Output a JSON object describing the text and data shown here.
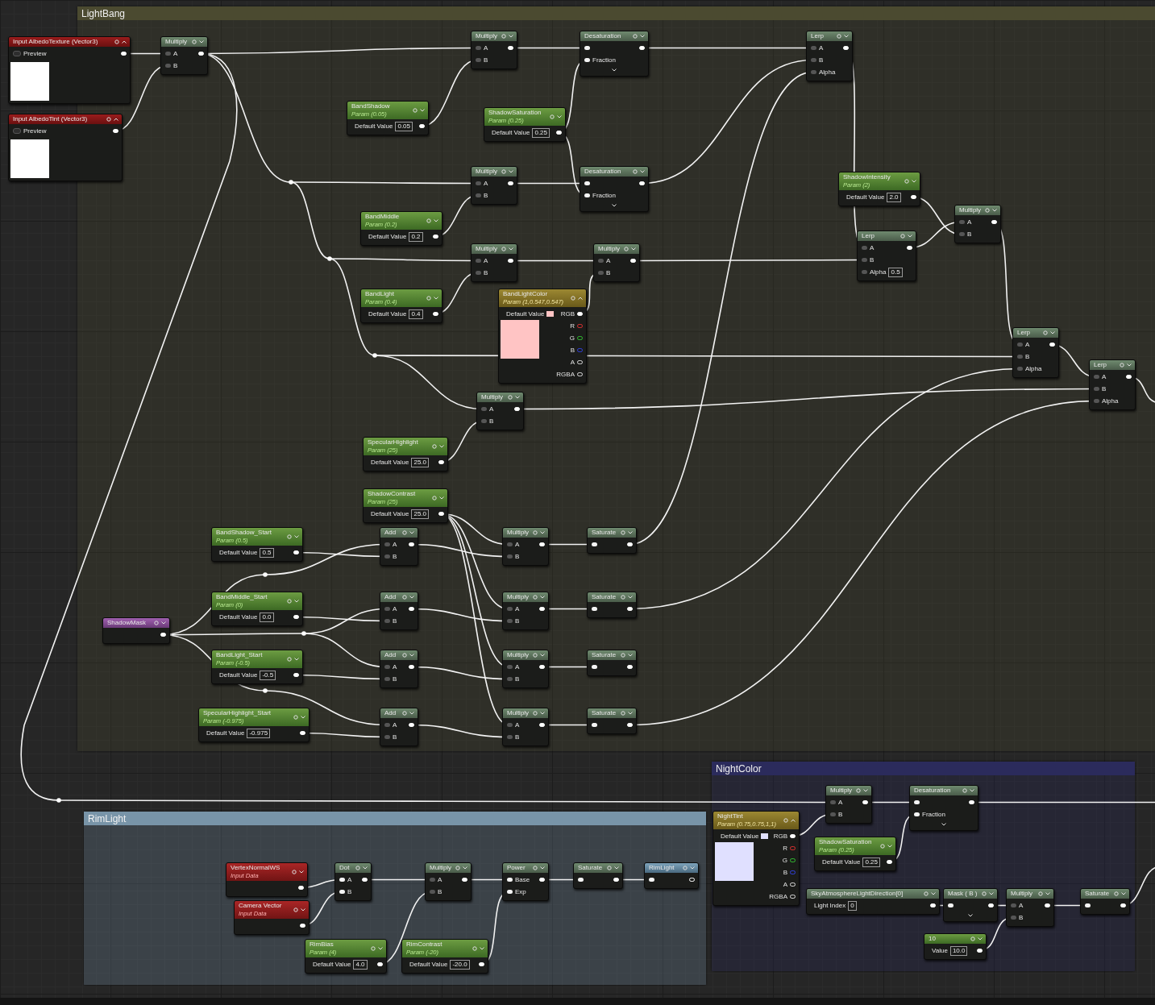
{
  "comments": [
    {
      "title": "LightBang",
      "color": "#4b4a30"
    },
    {
      "title": "RimLight",
      "color": "#7894a8"
    },
    {
      "title": "NightColor",
      "color": "#2b2b5c"
    }
  ],
  "nodes": [
    {
      "kind": "texture",
      "title": "Input AlbedoTexture (Vector3)",
      "expanded": true,
      "field": {
        "label": "Preview"
      }
    },
    {
      "kind": "texture",
      "title": "Input AlbedoTint (Vector3)",
      "expanded": true,
      "field": {
        "label": "Preview"
      }
    },
    {
      "kind": "function",
      "title": "Multiply",
      "expanded": false,
      "inputs": [
        {
          "label": "A",
          "filled": false
        },
        {
          "label": "B",
          "filled": false
        }
      ]
    },
    {
      "kind": "function",
      "title": "Multiply",
      "expanded": false,
      "inputs": [
        {
          "label": "A",
          "filled": false
        },
        {
          "label": "B",
          "filled": false
        }
      ]
    },
    {
      "kind": "param",
      "title": "BandShadow",
      "subtitle": "Param (0.05)",
      "expanded": false,
      "field": {
        "label": "Default Value",
        "value": "0.05"
      }
    },
    {
      "kind": "param",
      "title": "ShadowSaturation",
      "subtitle": "Param (0.25)",
      "expanded": false,
      "field": {
        "label": "Default Value",
        "value": "0.25"
      }
    },
    {
      "kind": "collapsible",
      "title": "Desaturation",
      "expanded": false,
      "inputs": [
        {
          "filled": true
        },
        {
          "label": "Fraction",
          "filled": true
        }
      ]
    },
    {
      "kind": "function",
      "title": "Lerp",
      "expanded": false,
      "inputs": [
        {
          "label": "A",
          "filled": false
        },
        {
          "label": "B",
          "filled": false
        },
        {
          "label": "Alpha",
          "filled": false
        }
      ]
    },
    {
      "kind": "function",
      "title": "Multiply",
      "expanded": false,
      "inputs": [
        {
          "label": "A",
          "filled": false
        },
        {
          "label": "B",
          "filled": false
        }
      ]
    },
    {
      "kind": "collapsible",
      "title": "Desaturation",
      "expanded": false,
      "inputs": [
        {
          "filled": true
        },
        {
          "label": "Fraction",
          "filled": true
        }
      ]
    },
    {
      "kind": "param",
      "title": "BandMiddle",
      "subtitle": "Param (0.2)",
      "expanded": false,
      "field": {
        "label": "Default Value",
        "value": "0.2"
      }
    },
    {
      "kind": "param",
      "title": "ShadowIntensity",
      "subtitle": "Param (2)",
      "expanded": false,
      "field": {
        "label": "Default Value",
        "value": "2.0"
      }
    },
    {
      "kind": "function",
      "title": "Multiply",
      "expanded": false,
      "inputs": [
        {
          "label": "A",
          "filled": false
        },
        {
          "label": "B",
          "filled": false
        }
      ]
    },
    {
      "kind": "function",
      "title": "Multiply",
      "expanded": false,
      "inputs": [
        {
          "label": "A",
          "filled": false
        },
        {
          "label": "B",
          "filled": false
        }
      ]
    },
    {
      "kind": "function",
      "title": "Multiply",
      "expanded": false,
      "inputs": [
        {
          "label": "A",
          "filled": false
        },
        {
          "label": "B",
          "filled": false
        }
      ]
    },
    {
      "kind": "function",
      "title": "Lerp",
      "expanded": false,
      "inputs": [
        {
          "label": "A",
          "filled": false
        },
        {
          "label": "B",
          "filled": false
        },
        {
          "label": "Alpha",
          "value": "0.5",
          "filled": false
        }
      ]
    },
    {
      "kind": "param",
      "title": "BandLight",
      "subtitle": "Param (0.4)",
      "expanded": false,
      "field": {
        "label": "Default Value",
        "value": "0.4"
      }
    },
    {
      "kind": "vector",
      "title": "BandLightColor",
      "subtitle": "Param (1,0.547,0.547)",
      "expanded": true,
      "field": {
        "label": "Default Value"
      },
      "outputs": [
        "RGB",
        "R",
        "G",
        "B",
        "A",
        "RGBA"
      ],
      "color": "#ffc4c4"
    },
    {
      "kind": "function",
      "title": "Lerp",
      "expanded": false,
      "inputs": [
        {
          "label": "A",
          "filled": false
        },
        {
          "label": "B",
          "filled": false
        },
        {
          "label": "Alpha",
          "filled": false
        }
      ]
    },
    {
      "kind": "function",
      "title": "Lerp",
      "expanded": false,
      "inputs": [
        {
          "label": "A",
          "filled": false
        },
        {
          "label": "B",
          "filled": false
        },
        {
          "label": "Alpha",
          "filled": false
        }
      ]
    },
    {
      "kind": "function",
      "title": "Multiply",
      "expanded": false,
      "inputs": [
        {
          "label": "A",
          "filled": false
        },
        {
          "label": "B",
          "filled": false
        }
      ]
    },
    {
      "kind": "param",
      "title": "SpecularHighlight",
      "subtitle": "Param (25)",
      "expanded": false,
      "field": {
        "label": "Default Value",
        "value": "25.0"
      }
    },
    {
      "kind": "param",
      "title": "ShadowContrast",
      "subtitle": "Param (25)",
      "expanded": false,
      "field": {
        "label": "Default Value",
        "value": "25.0"
      }
    },
    {
      "kind": "param",
      "title": "BandShadow_Start",
      "subtitle": "Param (0.5)",
      "expanded": false,
      "field": {
        "label": "Default Value",
        "value": "0.5"
      }
    },
    {
      "kind": "function",
      "title": "Add",
      "expanded": false,
      "inputs": [
        {
          "label": "A",
          "filled": false
        },
        {
          "label": "B",
          "filled": false
        }
      ]
    },
    {
      "kind": "function",
      "title": "Multiply",
      "expanded": false,
      "inputs": [
        {
          "label": "A",
          "filled": false
        },
        {
          "label": "B",
          "filled": false
        }
      ]
    },
    {
      "kind": "function",
      "title": "Saturate",
      "expanded": false,
      "inputs": [
        {
          "filled": true
        }
      ]
    },
    {
      "kind": "mask",
      "title": "ShadowMask",
      "expanded": false
    },
    {
      "kind": "param",
      "title": "BandMiddle_Start",
      "subtitle": "Param (0)",
      "expanded": false,
      "field": {
        "label": "Default Value",
        "value": "0.0"
      }
    },
    {
      "kind": "function",
      "title": "Add",
      "expanded": false,
      "inputs": [
        {
          "label": "A",
          "filled": false
        },
        {
          "label": "B",
          "filled": false
        }
      ]
    },
    {
      "kind": "function",
      "title": "Multiply",
      "expanded": false,
      "inputs": [
        {
          "label": "A",
          "filled": false
        },
        {
          "label": "B",
          "filled": false
        }
      ]
    },
    {
      "kind": "function",
      "title": "Saturate",
      "expanded": false,
      "inputs": [
        {
          "filled": true
        }
      ]
    },
    {
      "kind": "param",
      "title": "BandLight_Start",
      "subtitle": "Param (-0.5)",
      "expanded": false,
      "field": {
        "label": "Default Value",
        "value": "-0.5"
      }
    },
    {
      "kind": "function",
      "title": "Add",
      "expanded": false,
      "inputs": [
        {
          "label": "A",
          "filled": false
        },
        {
          "label": "B",
          "filled": false
        }
      ]
    },
    {
      "kind": "function",
      "title": "Multiply",
      "expanded": false,
      "inputs": [
        {
          "label": "A",
          "filled": false
        },
        {
          "label": "B",
          "filled": false
        }
      ]
    },
    {
      "kind": "function",
      "title": "Saturate",
      "expanded": false,
      "inputs": [
        {
          "filled": true
        }
      ]
    },
    {
      "kind": "param",
      "title": "SpecularHighlight_Start",
      "subtitle": "Param (-0.975)",
      "expanded": false,
      "field": {
        "label": "Default Value",
        "value": "-0.975"
      }
    },
    {
      "kind": "function",
      "title": "Add",
      "expanded": false,
      "inputs": [
        {
          "label": "A",
          "filled": false
        },
        {
          "label": "B",
          "filled": false
        }
      ]
    },
    {
      "kind": "function",
      "title": "Multiply",
      "expanded": false,
      "inputs": [
        {
          "label": "A",
          "filled": false
        },
        {
          "label": "B",
          "filled": false
        }
      ]
    },
    {
      "kind": "function",
      "title": "Saturate",
      "expanded": false,
      "inputs": [
        {
          "filled": true
        }
      ]
    },
    {
      "kind": "input",
      "title": "VertexNormalWS",
      "subtitle": "Input Data",
      "expanded": false
    },
    {
      "kind": "input",
      "title": "Camera Vector",
      "subtitle": "Input Data",
      "expanded": false
    },
    {
      "kind": "function",
      "title": "Dot",
      "expanded": false,
      "inputs": [
        {
          "label": "A",
          "filled": true
        },
        {
          "label": "B",
          "filled": true
        }
      ]
    },
    {
      "kind": "function",
      "title": "Multiply",
      "expanded": false,
      "inputs": [
        {
          "label": "A",
          "filled": false
        },
        {
          "label": "B",
          "filled": false
        }
      ]
    },
    {
      "kind": "function",
      "title": "Power",
      "expanded": false,
      "inputs": [
        {
          "label": "Base",
          "filled": true
        },
        {
          "label": "Exp",
          "filled": true
        }
      ]
    },
    {
      "kind": "function",
      "title": "Saturate",
      "expanded": false,
      "inputs": [
        {
          "filled": true
        }
      ]
    },
    {
      "kind": "output",
      "title": "RimLight",
      "expanded": false
    },
    {
      "kind": "param",
      "title": "RimBias",
      "subtitle": "Param (4)",
      "expanded": false,
      "field": {
        "label": "Default Value",
        "value": "4.0"
      }
    },
    {
      "kind": "param",
      "title": "RimContrast",
      "subtitle": "Param (-20)",
      "expanded": false,
      "field": {
        "label": "Default Value",
        "value": "-20.0"
      }
    },
    {
      "kind": "function",
      "title": "Multiply",
      "expanded": false,
      "inputs": [
        {
          "label": "A",
          "filled": false
        },
        {
          "label": "B",
          "filled": false
        }
      ]
    },
    {
      "kind": "collapsible",
      "title": "Desaturation",
      "expanded": false,
      "inputs": [
        {
          "filled": true
        },
        {
          "label": "Fraction",
          "filled": true
        }
      ]
    },
    {
      "kind": "vector",
      "title": "NightTint",
      "subtitle": "Param (0.75,0.75,1,1)",
      "expanded": true,
      "field": {
        "label": "Default Value"
      },
      "outputs": [
        "RGB",
        "R",
        "G",
        "B",
        "A",
        "RGBA"
      ],
      "color": "#e0e0ff"
    },
    {
      "kind": "param",
      "title": "ShadowSaturation",
      "subtitle": "Param (0.25)",
      "expanded": false,
      "field": {
        "label": "Default Value",
        "value": "0.25"
      }
    },
    {
      "kind": "function",
      "title": "SkyAtmosphereLightDirection[0]",
      "expanded": false,
      "field": {
        "label": "Light Index",
        "value": "0"
      }
    },
    {
      "kind": "collapsible",
      "title": "Mask ( B )",
      "expanded": false,
      "inputs": [
        {
          "filled": true
        }
      ]
    },
    {
      "kind": "function",
      "title": "Multiply",
      "expanded": false,
      "inputs": [
        {
          "label": "A",
          "filled": false
        },
        {
          "label": "B",
          "filled": false
        }
      ]
    },
    {
      "kind": "function",
      "title": "Saturate",
      "expanded": false,
      "inputs": [
        {
          "filled": true
        }
      ]
    },
    {
      "kind": "constant",
      "title": "10",
      "expanded": false,
      "field": {
        "label": "Value",
        "value": "10.0"
      }
    }
  ]
}
